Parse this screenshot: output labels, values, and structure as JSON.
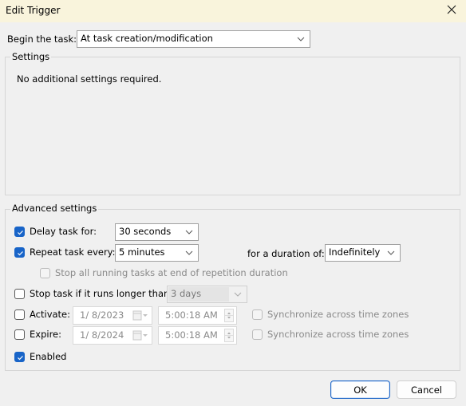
{
  "window": {
    "title": "Edit Trigger",
    "close_icon": "close-x-icon"
  },
  "begin_task": {
    "label": "Begin the task:",
    "value": "At task creation/modification"
  },
  "settings": {
    "title": "Settings",
    "message": "No additional settings required."
  },
  "advanced": {
    "title": "Advanced settings",
    "delay": {
      "label": "Delay task for:",
      "checked": true,
      "value": "30 seconds"
    },
    "repeat": {
      "label": "Repeat task every:",
      "checked": true,
      "value": "5 minutes"
    },
    "duration": {
      "label": "for a duration of:",
      "value": "Indefinitely"
    },
    "stop_all": {
      "label": "Stop all running tasks at end of repetition duration",
      "checked": false,
      "enabled": false
    },
    "stop_longer": {
      "label": "Stop task if it runs longer than:",
      "checked": false,
      "value": "3 days",
      "enabled": false
    },
    "activate": {
      "label": "Activate:",
      "checked": false,
      "date": "1/  8/2023",
      "time": "5:00:18 AM",
      "sync_label": "Synchronize across time zones",
      "sync_checked": false
    },
    "expire": {
      "label": "Expire:",
      "checked": false,
      "date": "1/  8/2024",
      "time": "5:00:18 AM",
      "sync_label": "Synchronize across time zones",
      "sync_checked": false
    },
    "enabled": {
      "label": "Enabled",
      "checked": true
    }
  },
  "buttons": {
    "ok": "OK",
    "cancel": "Cancel"
  },
  "colors": {
    "titlebar": "#f9f4dc",
    "accent": "#1864c8",
    "background": "#f0f0f0"
  }
}
